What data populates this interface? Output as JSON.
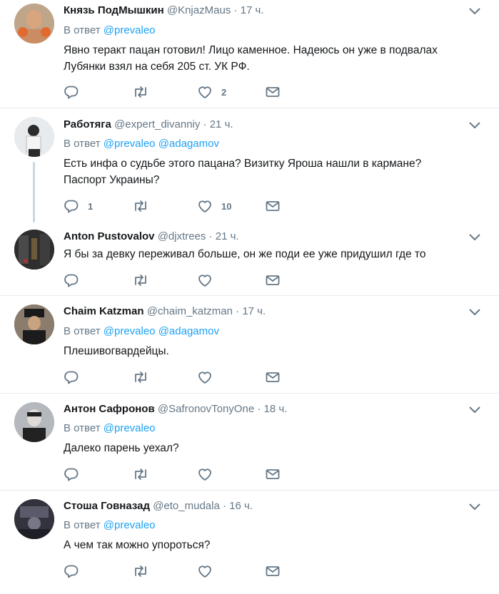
{
  "labels": {
    "reply_prefix": "В ответ"
  },
  "colors": {
    "link": "#1da1f2",
    "secondary": "#657786",
    "divider": "#e6ecf0",
    "thread_line": "#ccd6dd"
  },
  "tweets": [
    {
      "name": "Князь ПодМышкин",
      "handle": "@KnjazMaus",
      "time": "17 ч.",
      "mentions": [
        "@prevaleo"
      ],
      "text": "Явно теракт пацан готовил! Лицо каменное. Надеюсь он уже в подвалах Лубянки взял на себя 205 ст. УК РФ.",
      "replies": "",
      "retweets": "",
      "likes": "2"
    },
    {
      "name": "Работяга",
      "handle": "@expert_divanniy",
      "time": "21 ч.",
      "mentions": [
        "@prevaleo",
        "@adagamov"
      ],
      "text": "Есть инфа о судьбе этого пацана? Визитку Яроша нашли в кармане? Паспорт Украины?",
      "replies": "1",
      "retweets": "",
      "likes": "10"
    },
    {
      "name": "Anton Pustovalov",
      "handle": "@djxtrees",
      "time": "21 ч.",
      "mentions": [],
      "text": "Я бы за девку переживал больше, он же поди ее уже придушил где то",
      "replies": "",
      "retweets": "",
      "likes": ""
    },
    {
      "name": "Chaim Katzman",
      "handle": "@chaim_katzman",
      "time": "17 ч.",
      "mentions": [
        "@prevaleo",
        "@adagamov"
      ],
      "text": "Плешивогвардейцы.",
      "replies": "",
      "retweets": "",
      "likes": ""
    },
    {
      "name": "Антон Сафронов",
      "handle": "@SafronovTonyOne",
      "time": "18 ч.",
      "mentions": [
        "@prevaleo"
      ],
      "text": "Далеко парень уехал?",
      "replies": "",
      "retweets": "",
      "likes": ""
    },
    {
      "name": "Стоша Говназад",
      "handle": "@eto_mudala",
      "time": "16 ч.",
      "mentions": [
        "@prevaleo"
      ],
      "text": "А чем так можно упороться?",
      "replies": "",
      "retweets": "",
      "likes": ""
    }
  ]
}
